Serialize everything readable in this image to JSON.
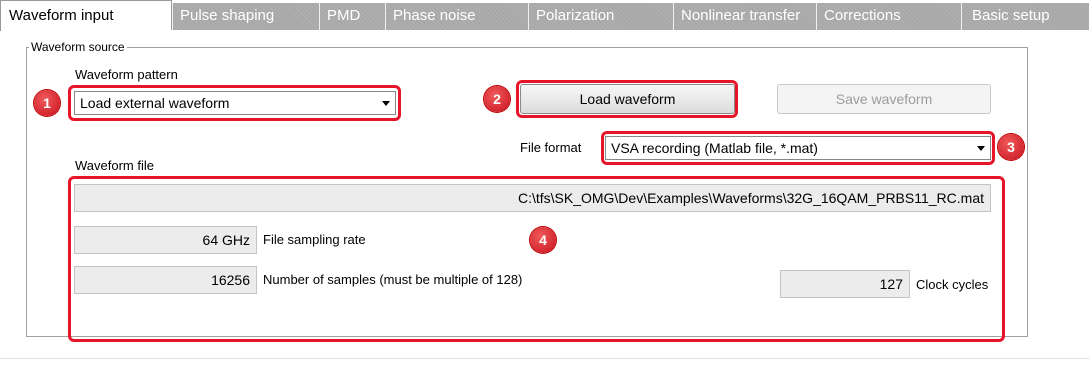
{
  "tabs": [
    {
      "label": "Waveform input",
      "active": true
    },
    {
      "label": "Pulse shaping",
      "active": false
    },
    {
      "label": "PMD",
      "active": false
    },
    {
      "label": "Phase noise",
      "active": false
    },
    {
      "label": "Polarization",
      "active": false
    },
    {
      "label": "Nonlinear transfer",
      "active": false
    },
    {
      "label": "Corrections",
      "active": false
    },
    {
      "label": "Basic setup",
      "active": false
    }
  ],
  "group": {
    "title": "Waveform source"
  },
  "pattern": {
    "label": "Waveform pattern",
    "selected": "Load external waveform"
  },
  "buttons": {
    "load": "Load waveform",
    "save": "Save waveform"
  },
  "file_format": {
    "label": "File format",
    "selected": "VSA recording (Matlab file, *.mat)"
  },
  "waveform_file": {
    "label": "Waveform file",
    "path": "C:\\tfs\\SK_OMG\\Dev\\Examples\\Waveforms\\32G_16QAM_PRBS11_RC.mat"
  },
  "sampling": {
    "value": "64 GHz",
    "label": "File sampling rate"
  },
  "samples": {
    "value": "16256",
    "label": "Number of samples (must be multiple of 128)"
  },
  "clock": {
    "value": "127",
    "label": "Clock cycles"
  },
  "annotations": [
    "1",
    "2",
    "3",
    "4"
  ],
  "colors": {
    "highlight": "#e8142a",
    "tab_inactive": "#a8a8a8",
    "field_bg": "#ececec"
  }
}
